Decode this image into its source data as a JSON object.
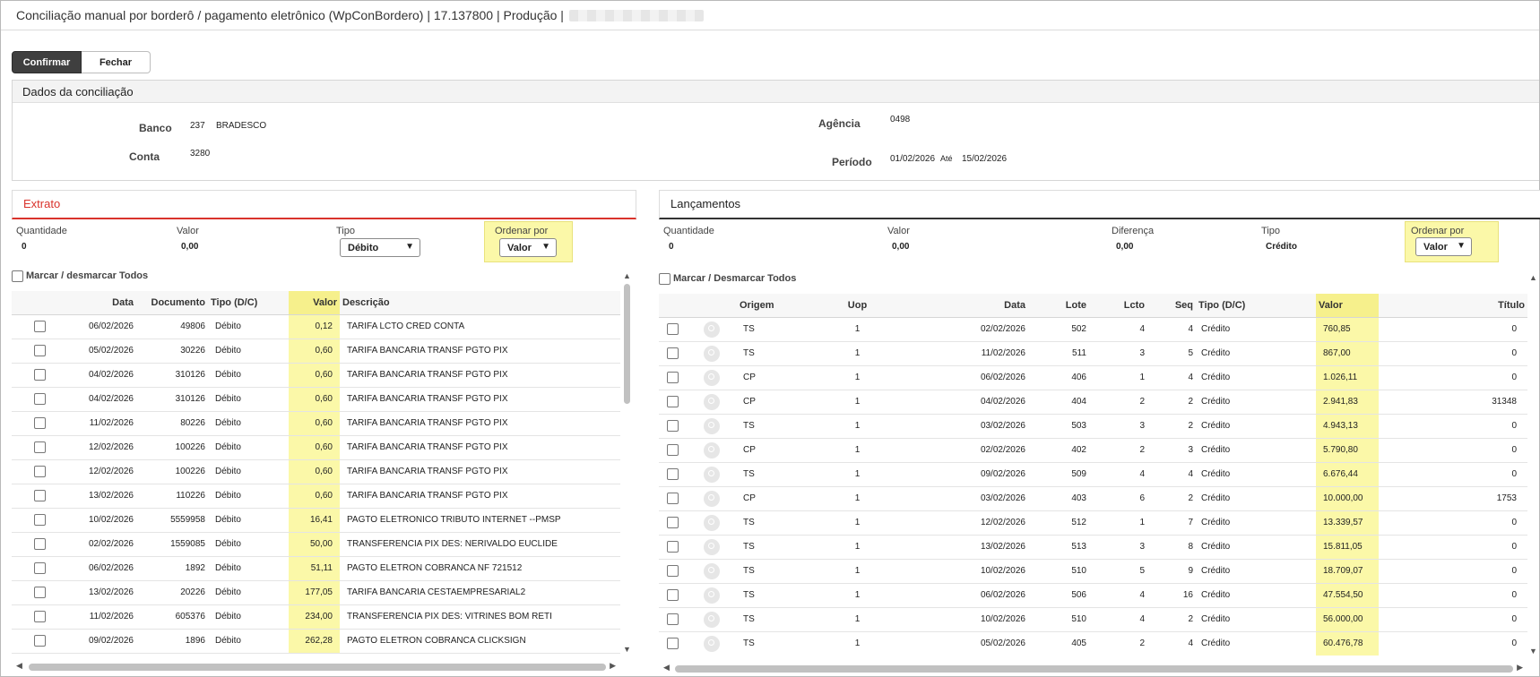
{
  "window": {
    "title": "Conciliação manual por borderô / pagamento eletrônico (WpConBordero) | 17.137800 | Produção |"
  },
  "toolbar": {
    "confirm_label": "Confirmar",
    "close_label": "Fechar"
  },
  "dados": {
    "header": "Dados da conciliação",
    "banco_label": "Banco",
    "banco_code": "237",
    "banco_name": "BRADESCO",
    "conta_label": "Conta",
    "conta_value": "3280",
    "agencia_label": "Agência",
    "agencia_value": "0498",
    "periodo_label": "Período",
    "periodo_from": "01/02/2026",
    "ate_label": "Até",
    "periodo_to": "15/02/2026"
  },
  "extrato": {
    "title": "Extrato",
    "quantidade_label": "Quantidade",
    "quantidade_value": "0",
    "valor_label": "Valor",
    "valor_value": "0,00",
    "tipo_label": "Tipo",
    "tipo_value": "Débito",
    "ordenar_label": "Ordenar por",
    "ordenar_value": "Valor",
    "marcar_label": "Marcar / desmarcar Todos",
    "columns": [
      "Data",
      "Documento",
      "Tipo (D/C)",
      "Valor",
      "Descrição"
    ],
    "rows": [
      [
        "06/02/2026",
        "49806",
        "Débito",
        "0,12",
        "TARIFA LCTO CRED CONTA"
      ],
      [
        "05/02/2026",
        "30226",
        "Débito",
        "0,60",
        "TARIFA BANCARIA TRANSF PGTO PIX"
      ],
      [
        "04/02/2026",
        "310126",
        "Débito",
        "0,60",
        "TARIFA BANCARIA TRANSF PGTO PIX"
      ],
      [
        "04/02/2026",
        "310126",
        "Débito",
        "0,60",
        "TARIFA BANCARIA TRANSF PGTO PIX"
      ],
      [
        "11/02/2026",
        "80226",
        "Débito",
        "0,60",
        "TARIFA BANCARIA TRANSF PGTO PIX"
      ],
      [
        "12/02/2026",
        "100226",
        "Débito",
        "0,60",
        "TARIFA BANCARIA TRANSF PGTO PIX"
      ],
      [
        "12/02/2026",
        "100226",
        "Débito",
        "0,60",
        "TARIFA BANCARIA TRANSF PGTO PIX"
      ],
      [
        "13/02/2026",
        "110226",
        "Débito",
        "0,60",
        "TARIFA BANCARIA TRANSF PGTO PIX"
      ],
      [
        "10/02/2026",
        "5559958",
        "Débito",
        "16,41",
        "PAGTO ELETRONICO TRIBUTO INTERNET --PMSP"
      ],
      [
        "02/02/2026",
        "1559085",
        "Débito",
        "50,00",
        "TRANSFERENCIA PIX DES: NERIVALDO EUCLIDE"
      ],
      [
        "06/02/2026",
        "1892",
        "Débito",
        "51,11",
        "PAGTO ELETRON COBRANCA NF 721512"
      ],
      [
        "13/02/2026",
        "20226",
        "Débito",
        "177,05",
        "TARIFA BANCARIA CESTAEMPRESARIAL2"
      ],
      [
        "11/02/2026",
        "605376",
        "Débito",
        "234,00",
        "TRANSFERENCIA PIX DES: VITRINES BOM RETI"
      ],
      [
        "09/02/2026",
        "1896",
        "Débito",
        "262,28",
        "PAGTO ELETRON COBRANCA CLICKSIGN"
      ]
    ]
  },
  "lancamentos": {
    "title": "Lançamentos",
    "quantidade_label": "Quantidade",
    "quantidade_value": "0",
    "valor_label": "Valor",
    "valor_value": "0,00",
    "diferenca_label": "Diferença",
    "diferenca_value": "0,00",
    "tipo_label": "Tipo",
    "tipo_value": "Crédito",
    "ordenar_label": "Ordenar por",
    "ordenar_value": "Valor",
    "marcar_label": "Marcar / Desmarcar Todos",
    "columns": [
      "Origem",
      "Uop",
      "Data",
      "Lote",
      "Lcto",
      "Seq",
      "Tipo (D/C)",
      "Valor",
      "Título"
    ],
    "rows": [
      [
        "TS",
        "1",
        "02/02/2026",
        "502",
        "4",
        "4",
        "Crédito",
        "760,85",
        "0"
      ],
      [
        "TS",
        "1",
        "11/02/2026",
        "511",
        "3",
        "5",
        "Crédito",
        "867,00",
        "0"
      ],
      [
        "CP",
        "1",
        "06/02/2026",
        "406",
        "1",
        "4",
        "Crédito",
        "1.026,11",
        "0"
      ],
      [
        "CP",
        "1",
        "04/02/2026",
        "404",
        "2",
        "2",
        "Crédito",
        "2.941,83",
        "31348"
      ],
      [
        "TS",
        "1",
        "03/02/2026",
        "503",
        "3",
        "2",
        "Crédito",
        "4.943,13",
        "0"
      ],
      [
        "CP",
        "1",
        "02/02/2026",
        "402",
        "2",
        "3",
        "Crédito",
        "5.790,80",
        "0"
      ],
      [
        "TS",
        "1",
        "09/02/2026",
        "509",
        "4",
        "4",
        "Crédito",
        "6.676,44",
        "0"
      ],
      [
        "CP",
        "1",
        "03/02/2026",
        "403",
        "6",
        "2",
        "Crédito",
        "10.000,00",
        "1753"
      ],
      [
        "TS",
        "1",
        "12/02/2026",
        "512",
        "1",
        "7",
        "Crédito",
        "13.339,57",
        "0"
      ],
      [
        "TS",
        "1",
        "13/02/2026",
        "513",
        "3",
        "8",
        "Crédito",
        "15.811,05",
        "0"
      ],
      [
        "TS",
        "1",
        "10/02/2026",
        "510",
        "5",
        "9",
        "Crédito",
        "18.709,07",
        "0"
      ],
      [
        "TS",
        "1",
        "06/02/2026",
        "506",
        "4",
        "16",
        "Crédito",
        "47.554,50",
        "0"
      ],
      [
        "TS",
        "1",
        "10/02/2026",
        "510",
        "4",
        "2",
        "Crédito",
        "56.000,00",
        "0"
      ],
      [
        "TS",
        "1",
        "05/02/2026",
        "405",
        "2",
        "4",
        "Crédito",
        "60.476,78",
        "0"
      ]
    ]
  },
  "icons": {
    "row_search": "magnifier-icon",
    "dropdown": "chevron-down-icon"
  },
  "colors": {
    "accent_red": "#d9332c",
    "highlight_yellow": "#fbf8a8",
    "primary_button": "#3f3f3f"
  }
}
